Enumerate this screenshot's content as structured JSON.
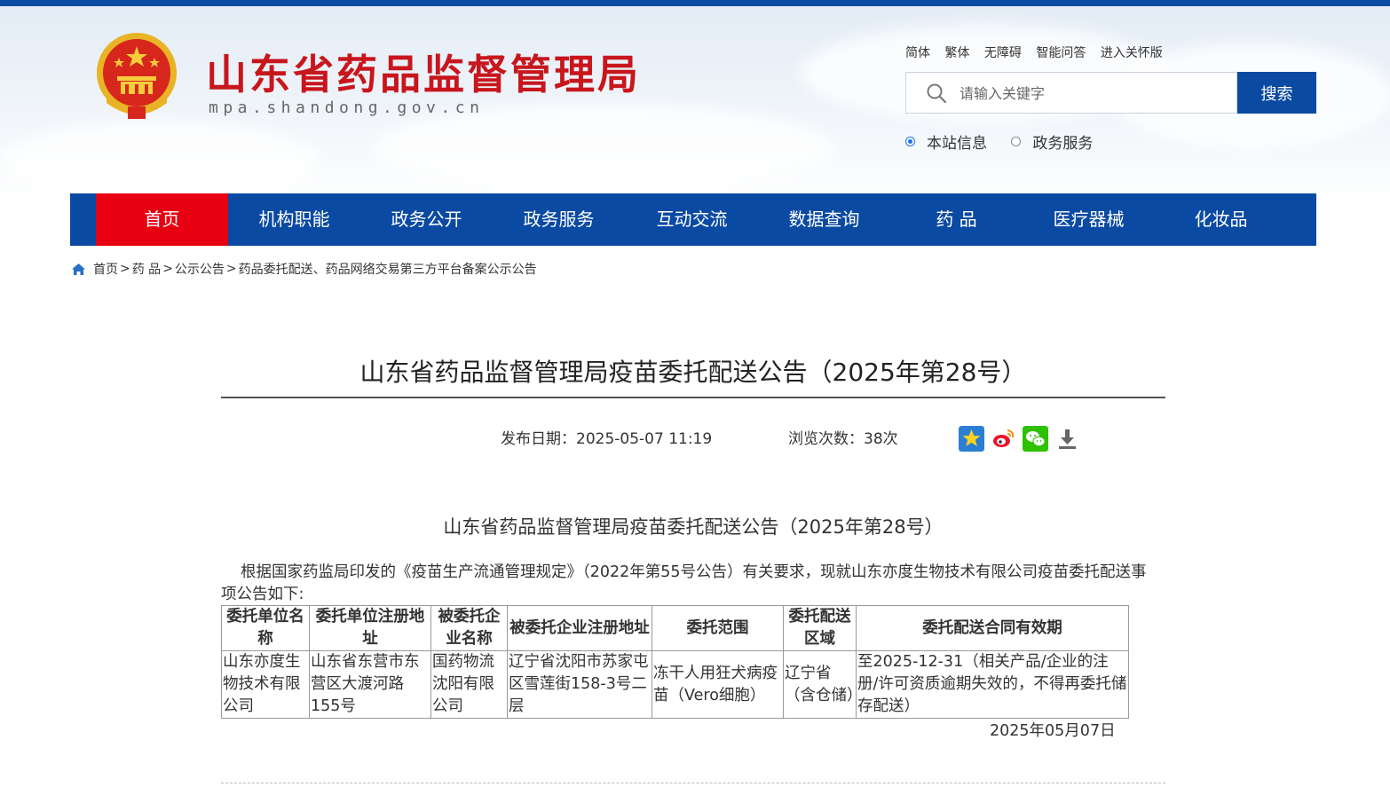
{
  "header": {
    "site_title": "山东省药品监督管理局",
    "site_domain": "mpa.shandong.gov.cn",
    "top_links": [
      "简体",
      "繁体",
      "无障碍",
      "智能问答",
      "进入关怀版"
    ],
    "search": {
      "placeholder": "请输入关键字",
      "button": "搜索"
    },
    "scope_options": [
      {
        "label": "本站信息",
        "selected": true
      },
      {
        "label": "政务服务",
        "selected": false
      }
    ]
  },
  "nav": {
    "items": [
      "首页",
      "机构职能",
      "政务公开",
      "政务服务",
      "互动交流",
      "数据查询",
      "药 品",
      "医疗器械",
      "化妆品"
    ],
    "active": "首页",
    "color": "#0b4aa2",
    "active_color": "#e60012"
  },
  "breadcrumb": [
    "首页",
    "药 品",
    "公示公告",
    "药品委托配送、药品网络交易第三方平台备案公示公告"
  ],
  "article": {
    "title": "山东省药品监督管理局疫苗委托配送公告（2025年第28号）",
    "publish_label": "发布日期：",
    "publish_date": "2025-05-07 11:19",
    "views_label": "浏览次数：",
    "views": "38次",
    "share_icons": [
      "favorite-star-icon",
      "weibo-icon",
      "wechat-icon",
      "download-icon"
    ],
    "content_title": "山东省药品监督管理局疫苗委托配送公告（2025年第28号）",
    "intro": "根据国家药监局印发的《疫苗生产流通管理规定》（2022年第55号公告）有关要求，现就山东亦度生物技术有限公司疫苗委托配送事项公告如下:",
    "table": {
      "headers": [
        "委托单位名称",
        "委托单位注册地址",
        "被委托企业名称",
        "被委托企业注册地址",
        "委托范围",
        "委托配送区域",
        "委托配送合同有效期"
      ],
      "rows": [
        [
          "山东亦度生物技术有限公司",
          "山东省东营市东营区大渡河路155号",
          "国药物流沈阳有限公司",
          "辽宁省沈阳市苏家屯区雪莲街158-3号二层",
          "冻干人用狂犬病疫苗（Vero细胞）",
          "辽宁省（含仓储）",
          "至2025-12-31（相关产品/企业的注册/许可资质逾期失效的，不得再委托储存配送）"
        ]
      ]
    },
    "sign_date": "2025年05月07日"
  }
}
